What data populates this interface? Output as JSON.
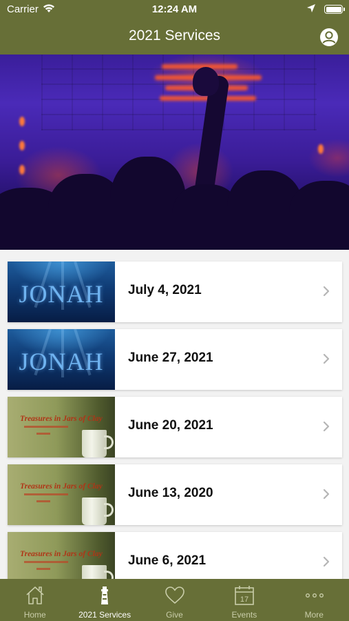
{
  "status_bar": {
    "carrier": "Carrier",
    "time": "12:24 AM"
  },
  "header": {
    "title": "2021 Services"
  },
  "services": [
    {
      "date": "July 4, 2021",
      "thumbnail_text": "JONAH",
      "theme": "jonah"
    },
    {
      "date": "June 27, 2021",
      "thumbnail_text": "JONAH",
      "theme": "jonah"
    },
    {
      "date": "June 20, 2021",
      "thumbnail_text": "Treasures in Jars of Clay",
      "theme": "clay"
    },
    {
      "date": "June 13, 2020",
      "thumbnail_text": "Treasures in Jars of Clay",
      "theme": "clay"
    },
    {
      "date": "June 6, 2021",
      "thumbnail_text": "Treasures in Jars of Clay",
      "theme": "clay"
    }
  ],
  "tabs": [
    {
      "label": "Home",
      "icon": "home-icon"
    },
    {
      "label": "2021 Services",
      "icon": "lighthouse-icon",
      "active": true
    },
    {
      "label": "Give",
      "icon": "heart-icon"
    },
    {
      "label": "Events",
      "icon": "calendar-icon",
      "calendar_day": "17"
    },
    {
      "label": "More",
      "icon": "more-dots-icon"
    }
  ],
  "colors": {
    "header_bg": "#676f37",
    "tab_active": "#ffffff",
    "tab_inactive": "#c9cda9",
    "list_bg": "#f2f2f2"
  }
}
